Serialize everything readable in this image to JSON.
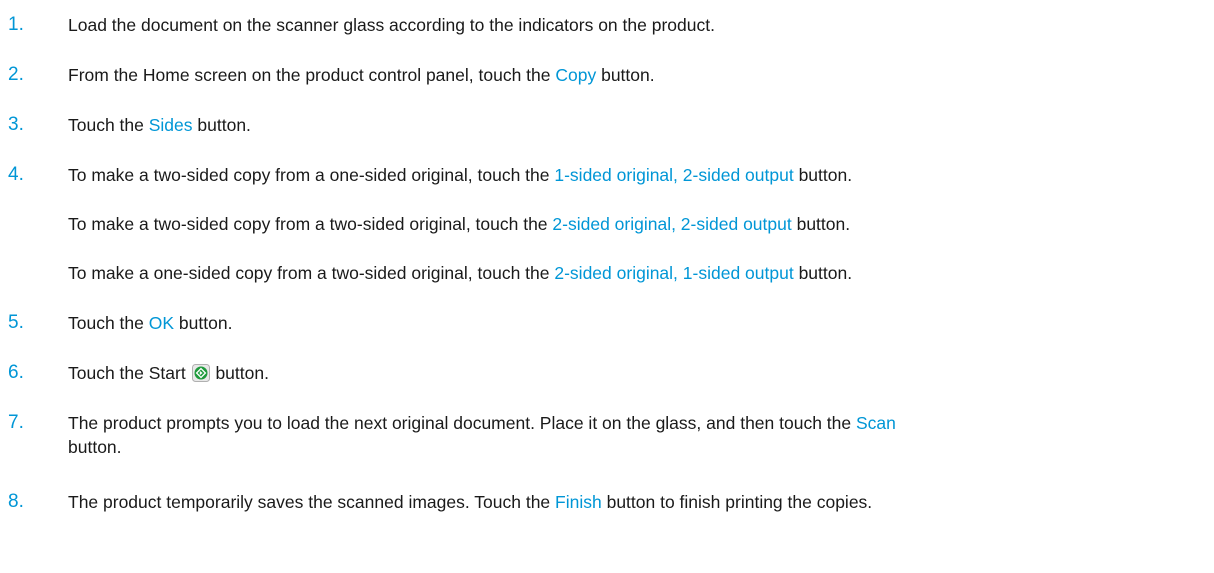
{
  "colors": {
    "accent": "#0096d6",
    "text": "#1a1a1a",
    "start_button": "#1e9a3c"
  },
  "steps": [
    {
      "number": "1.",
      "text": "Load the document on the scanner glass according to the indicators on the product."
    },
    {
      "number": "2.",
      "pre": "From the Home screen on the product control panel, touch the ",
      "ui": "Copy",
      "post": " button."
    },
    {
      "number": "3.",
      "pre": "Touch the ",
      "ui": "Sides",
      "post": " button."
    },
    {
      "number": "4.",
      "pre": "To make a two-sided copy from a one-sided original, touch the ",
      "ui": "1-sided original, 2-sided output",
      "post": " button."
    },
    {
      "pre": "To make a two-sided copy from a two-sided original, touch the ",
      "ui": "2-sided original, 2-sided output",
      "post": " button."
    },
    {
      "pre": "To make a one-sided copy from a two-sided original, touch the ",
      "ui": "2-sided original, 1-sided output",
      "post": " button."
    },
    {
      "number": "5.",
      "pre": "Touch the ",
      "ui": "OK",
      "post": " button."
    },
    {
      "number": "6.",
      "pre": "Touch the Start ",
      "icon": "start-icon",
      "post": " button."
    },
    {
      "number": "7.",
      "pre": "The product prompts you to load the next original document. Place it on the glass, and then touch the ",
      "ui": "Scan",
      "post": " button."
    },
    {
      "number": "8.",
      "pre": "The product temporarily saves the scanned images. Touch the ",
      "ui": "Finish",
      "post": " button to finish printing the copies."
    }
  ]
}
